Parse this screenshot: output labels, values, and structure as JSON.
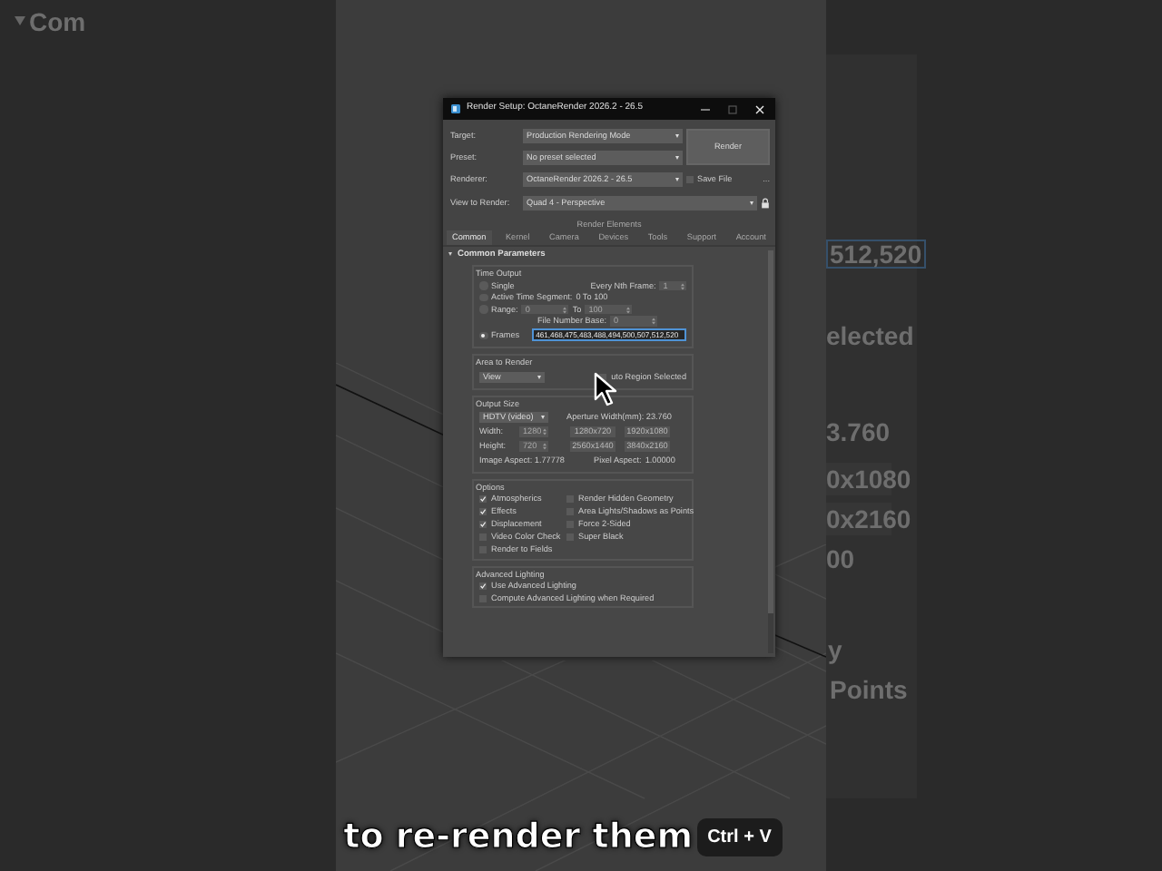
{
  "backdrop": {
    "left_texts": [
      "Com"
    ],
    "right_texts": [
      "512,520",
      "elected",
      "3.760",
      "0x1080",
      "0x2160",
      "00",
      "y",
      "Points"
    ]
  },
  "window": {
    "title": "Render Setup: OctaneRender 2026.2 - 26.5"
  },
  "setup": {
    "target": {
      "label": "Target:",
      "value": "Production Rendering Mode"
    },
    "preset": {
      "label": "Preset:",
      "value": "No preset selected"
    },
    "renderer": {
      "label": "Renderer:",
      "value": "OctaneRender 2026.2 - 26.5"
    },
    "save_file": {
      "label": "Save File",
      "checked": false
    },
    "more_button": "...",
    "view_to_render": {
      "label": "View to Render:",
      "value": "Quad 4 - Perspective"
    },
    "render_button": "Render",
    "locked": true
  },
  "render_elements": "Render Elements",
  "tabs": [
    {
      "label": "Common",
      "selected": true
    },
    {
      "label": "Kernel",
      "selected": false
    },
    {
      "label": "Camera",
      "selected": false
    },
    {
      "label": "Devices",
      "selected": false
    },
    {
      "label": "Tools",
      "selected": false
    },
    {
      "label": "Support",
      "selected": false
    },
    {
      "label": "Account",
      "selected": false
    }
  ],
  "rollout": {
    "title": "Common Parameters",
    "expanded": true
  },
  "time_output": {
    "title": "Time Output",
    "modes": [
      {
        "label": "Single",
        "selected": false
      },
      {
        "label": "Active Time Segment:",
        "selected": false
      },
      {
        "label": "Range:",
        "selected": false
      },
      {
        "label": "Frames",
        "selected": true
      }
    ],
    "every_nth": {
      "label": "Every Nth Frame:",
      "value": "1"
    },
    "active_segment": "0 To 100",
    "range": {
      "from": "0",
      "to_label": "To",
      "to": "100"
    },
    "file_number_base": {
      "label": "File Number Base:",
      "value": "0"
    },
    "frames": "461,468,475,483,488,494,500,507,512,520"
  },
  "area_to_render": {
    "title": "Area to Render",
    "value": "View",
    "auto_region": {
      "label": "uto Region Selected",
      "checked": false
    }
  },
  "output_size": {
    "title": "Output Size",
    "preset": "HDTV (video)",
    "aperture": "Aperture Width(mm): 23.760",
    "width": {
      "label": "Width:",
      "value": "1280"
    },
    "height": {
      "label": "Height:",
      "value": "720"
    },
    "presets": [
      "1280x720",
      "1920x1080",
      "2560x1440",
      "3840x2160"
    ],
    "image_aspect": "Image Aspect: 1.77778",
    "pixel_aspect": {
      "label": "Pixel Aspect:",
      "value": "1.00000"
    }
  },
  "options": {
    "title": "Options",
    "items": [
      {
        "label": "Atmospherics",
        "checked": true
      },
      {
        "label": "Render Hidden Geometry",
        "checked": false
      },
      {
        "label": "Effects",
        "checked": true
      },
      {
        "label": "Area Lights/Shadows as Points",
        "checked": false
      },
      {
        "label": "Displacement",
        "checked": true
      },
      {
        "label": "Force 2-Sided",
        "checked": false
      },
      {
        "label": "Video Color Check",
        "checked": false
      },
      {
        "label": "Super Black",
        "checked": false
      },
      {
        "label": "Render to Fields",
        "checked": false
      }
    ]
  },
  "advanced_lighting": {
    "title": "Advanced Lighting",
    "items": [
      {
        "label": "Use Advanced Lighting",
        "checked": true
      },
      {
        "label": "Compute Advanced Lighting when Required",
        "checked": false
      }
    ]
  },
  "caption": {
    "text": "to re-render them",
    "shortcut": "Ctrl + V"
  }
}
